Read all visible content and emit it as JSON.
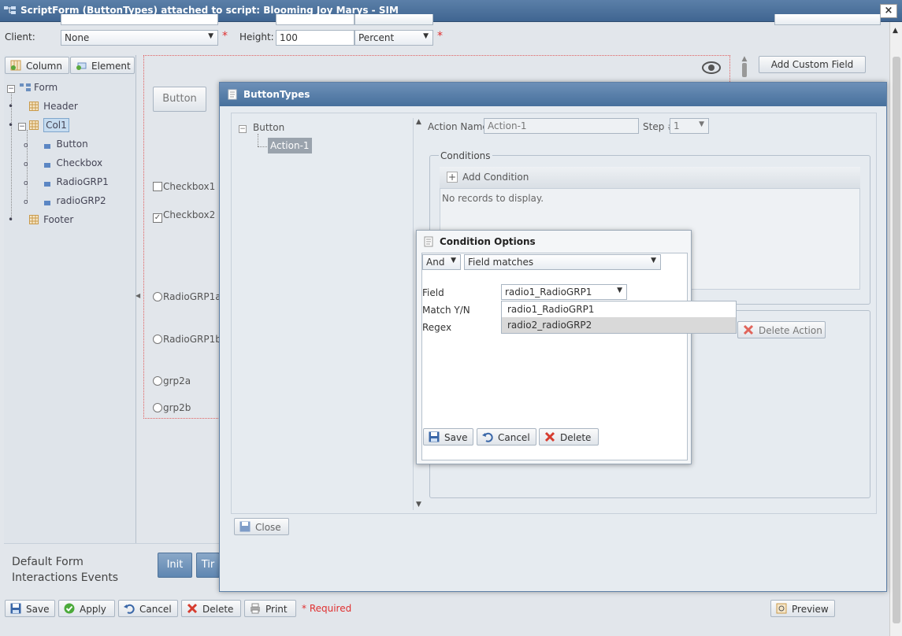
{
  "window": {
    "title": "ScriptForm (ButtonTypes) attached to script: Blooming Joy Marys - SIM",
    "close_label": "×"
  },
  "form": {
    "client_label": "Client:",
    "client_value": "None",
    "height_label": "Height:",
    "height_value": "100",
    "height_unit": "Percent",
    "required_mark": "*"
  },
  "left_toolbar": {
    "column_label": "Column",
    "element_label": "Element"
  },
  "tree": {
    "root": "Form",
    "header": "Header",
    "col1": "Col1",
    "button": "Button",
    "checkbox": "Checkbox",
    "radio1": "RadioGRP1",
    "radio2": "radioGRP2",
    "footer": "Footer"
  },
  "canvas": {
    "button_label": "Button",
    "checkbox1": "Checkbox1",
    "checkbox2": "Checkbox2",
    "radio1a": "RadioGRP1a",
    "radio1b": "RadioGRP1b",
    "grp2a": "grp2a",
    "grp2b": "grp2b",
    "add_custom_field": "Add Custom Field"
  },
  "events": {
    "label_line1": "Default Form",
    "label_line2": "Interactions Events",
    "init_button": "Init",
    "timer_button": "Tir"
  },
  "bottom_toolbar": {
    "save": "Save",
    "apply": "Apply",
    "cancel": "Cancel",
    "delete": "Delete",
    "print": "Print",
    "required_note": "* Required",
    "preview": "Preview"
  },
  "button_types_dialog": {
    "title": "ButtonTypes",
    "tree_root": "Button",
    "tree_child": "Action-1",
    "action_name_label": "Action Name",
    "action_name_value": "Action-1",
    "step_label": "Step #",
    "step_value": "1",
    "conditions_legend": "Conditions",
    "add_condition": "Add Condition",
    "no_records": "No records to display.",
    "delete_action": "Delete Action",
    "close": "Close"
  },
  "condition_dialog": {
    "title": "Condition Options",
    "logic_value": "And",
    "match_type": "Field matches",
    "field_label": "Field",
    "field_value": "radio1_RadioGRP1",
    "match_label": "Match Y/N",
    "regex_label": "Regex",
    "options": [
      "radio1_RadioGRP1",
      "radio2_radioGRP2"
    ],
    "save": "Save",
    "cancel": "Cancel",
    "delete": "Delete"
  }
}
